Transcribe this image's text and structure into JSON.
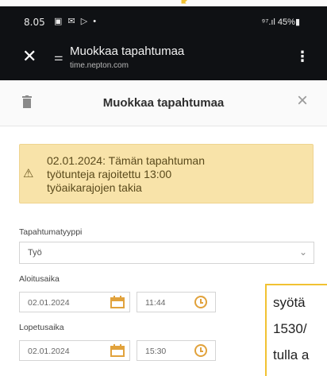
{
  "status_bar": {
    "time": "8.05",
    "notifications": "▣ ✉ ▷ •",
    "signal_battery": "⁹⁷.ıl 45%▮"
  },
  "browser": {
    "close_icon": "close-icon",
    "title": "Muokkaa tapahtumaa",
    "url": "time.nepton.com",
    "menu_icon": "more-vert-icon"
  },
  "dialog": {
    "title": "Muokkaa tapahtumaa",
    "delete_icon": "trash-icon",
    "close_icon": "close-icon"
  },
  "warning": {
    "line1": "02.01.2024: Tämän tapahtuman",
    "line2": "työtunteja rajoitettu 13:00",
    "line3": "työaikarajojen takia",
    "icon": "warning-icon"
  },
  "form": {
    "type_label": "Tapahtumatyyppi",
    "type_value": "Työ",
    "start_label": "Aloitusaika",
    "start_date": "02.01.2024",
    "start_time": "11:44",
    "end_label": "Lopetusaika",
    "end_date": "02.01.2024",
    "end_time": "15:30"
  },
  "note": {
    "line1": "syötä",
    "line2": "1530/",
    "line3": "tulla a"
  },
  "colors": {
    "dark_bar": "#0f1114",
    "warning_bg": "#f8e3a9",
    "accent": "#e1a23c",
    "note_border": "#f1c232"
  }
}
